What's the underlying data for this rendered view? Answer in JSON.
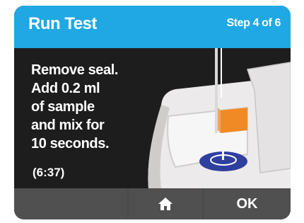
{
  "header": {
    "title": "Run Test",
    "step": "Step 4 of 6",
    "color": "#1fa8e3"
  },
  "instructions": {
    "lines": [
      "Remove seal.",
      "Add 0.2 ml",
      "of sample",
      "and mix for",
      "10 seconds."
    ],
    "timer": "(6:37)"
  },
  "footer": {
    "home_icon": "home-icon",
    "ok_label": "OK"
  },
  "colors": {
    "screen_bg": "#1e1d1e",
    "footer_button": "#505050",
    "accent_orange": "#f08a24",
    "well_blue": "#2e3f9e"
  }
}
